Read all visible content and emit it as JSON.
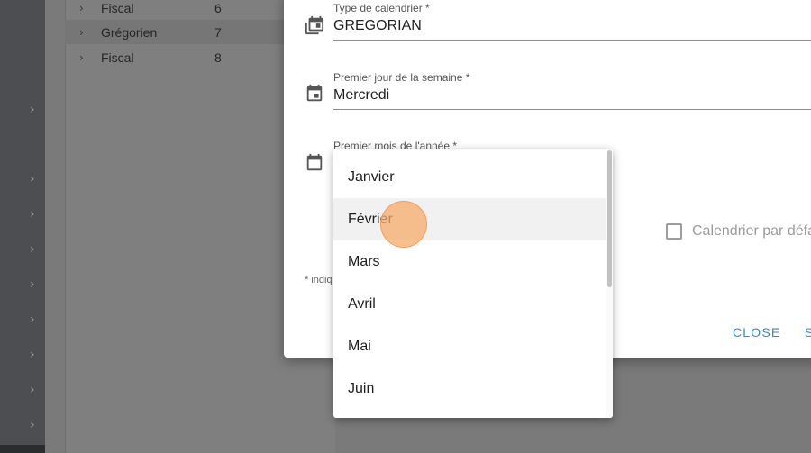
{
  "sidebar": {
    "chevron": "›"
  },
  "table": {
    "chevron": "›",
    "rows": [
      {
        "name": "Fiscal",
        "num": "6"
      },
      {
        "name": "Grégorien",
        "num": "7"
      },
      {
        "name": "Fiscal",
        "num": "8"
      }
    ]
  },
  "dialog": {
    "calendar_type": {
      "label": "Type de calendrier *",
      "value": "GREGORIAN",
      "icon": "calendar-multiple-icon"
    },
    "first_day": {
      "label": "Premier jour de la semaine *",
      "value": "Mercredi",
      "icon": "calendar-today-icon"
    },
    "first_month": {
      "label": "Premier mois de l'année *",
      "icon": "calendar-icon"
    },
    "default_checkbox_label": "Calendrier par défa",
    "required_note": "* indiq",
    "close_label": "CLOSE",
    "save_label": "S"
  },
  "menu": {
    "options": [
      "Janvier",
      "Février",
      "Mars",
      "Avril",
      "Mai",
      "Juin"
    ],
    "hovered": "Février"
  },
  "colors": {
    "accent": "#2e8ecb",
    "click_marker": "#f6aa69"
  }
}
